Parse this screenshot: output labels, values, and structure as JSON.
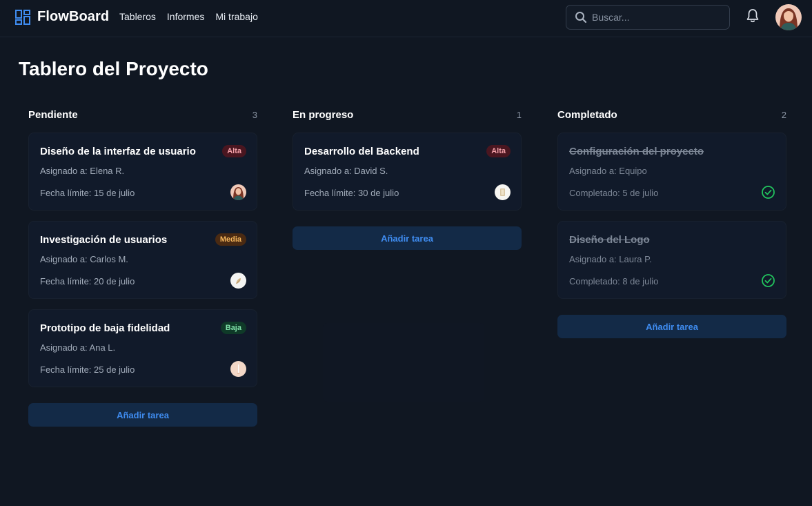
{
  "brand": {
    "name": "FlowBoard"
  },
  "nav": [
    {
      "label": "Tableros"
    },
    {
      "label": "Informes"
    },
    {
      "label": "Mi trabajo"
    }
  ],
  "search": {
    "placeholder": "Buscar..."
  },
  "page": {
    "title": "Tablero del Proyecto"
  },
  "colors": {
    "accent": "#3f8cf0",
    "alta": "#f3a0a8",
    "media": "#f5b65c",
    "baja": "#7fe0a8",
    "check": "#22c55e"
  },
  "columns": [
    {
      "title": "Pendiente",
      "count": "3",
      "cards": [
        {
          "title": "Diseño de la interfaz de usuario",
          "priority": "Alta",
          "assigned": "Asignado a: Elena R.",
          "date": "Fecha límite: 15 de julio"
        },
        {
          "title": "Investigación de usuarios",
          "priority": "Media",
          "assigned": "Asignado a: Carlos M.",
          "date": "Fecha límite: 20 de julio"
        },
        {
          "title": "Prototipo de baja fidelidad",
          "priority": "Baja",
          "assigned": "Asignado a: Ana L.",
          "date": "Fecha límite: 25 de julio"
        }
      ],
      "add_label": "Añadir tarea"
    },
    {
      "title": "En progreso",
      "count": "1",
      "cards": [
        {
          "title": "Desarrollo del Backend",
          "priority": "Alta",
          "assigned": "Asignado a: David S.",
          "date": "Fecha límite: 30 de julio"
        }
      ],
      "add_label": "Añadir tarea"
    },
    {
      "title": "Completado",
      "count": "2",
      "cards": [
        {
          "title": "Configuración del proyecto",
          "assigned": "Asignado a: Equipo",
          "date": "Completado: 5 de julio"
        },
        {
          "title": "Diseño del Logo",
          "assigned": "Asignado a: Laura P.",
          "date": "Completado: 8 de julio"
        }
      ],
      "add_label": "Añadir tarea"
    }
  ]
}
